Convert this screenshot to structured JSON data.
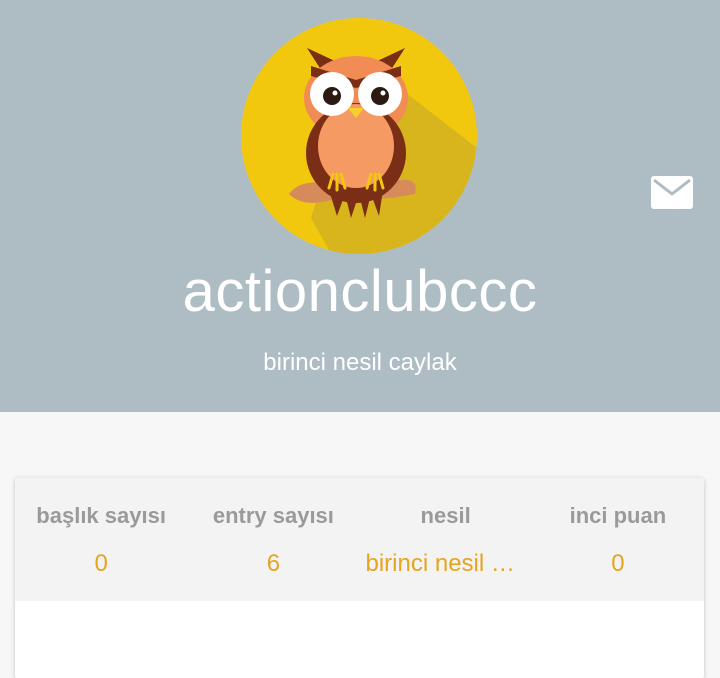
{
  "profile": {
    "username": "actionclubccc",
    "title": "birinci nesil caylak",
    "avatar_icon": "owl-avatar-icon",
    "message_icon": "envelope-icon"
  },
  "stats": [
    {
      "label": "başlık sayısı",
      "value": "0"
    },
    {
      "label": "entry sayısı",
      "value": "6"
    },
    {
      "label": "nesil",
      "value": "birinci nesil caylak"
    },
    {
      "label": "inci puan",
      "value": "0"
    }
  ],
  "colors": {
    "header_bg": "#aebcc4",
    "avatar_bg": "#f2c80f",
    "stat_value": "#e5a51e",
    "stat_label": "#9a9a9a"
  }
}
